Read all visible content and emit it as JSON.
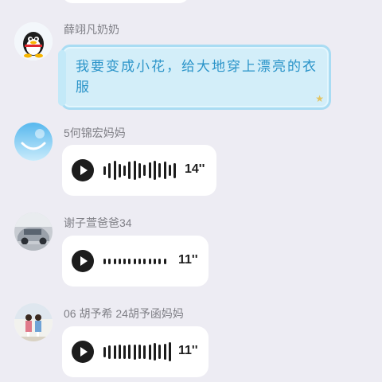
{
  "messages": [
    {
      "sender": "薛翊凡奶奶",
      "avatar_icon": "qq-penguin-avatar",
      "text": "我要变成小花，给大地穿上漂亮的衣服"
    },
    {
      "sender": "5何锦宏妈妈",
      "avatar_icon": "blue-smile-avatar",
      "voice": {
        "duration": "14''",
        "bar_heights_rel": [
          0.45,
          0.8,
          1,
          0.7,
          0.55,
          0.9,
          1,
          0.8,
          0.6,
          0.85,
          1,
          0.75,
          0.9,
          0.6,
          0.8
        ]
      }
    },
    {
      "sender": "谢子萱爸爸34",
      "avatar_icon": "car-photo-avatar",
      "voice": {
        "duration": "11''",
        "bar_heights_rel": [
          0.28,
          0.28,
          0.28,
          0.28,
          0.28,
          0.28,
          0.28,
          0.28,
          0.28,
          0.28,
          0.28,
          0.28,
          0.28
        ]
      }
    },
    {
      "sender": "06 胡予希 24胡予函妈妈",
      "avatar_icon": "children-photo-avatar",
      "voice": {
        "duration": "11''",
        "bar_heights_rel": [
          0.55,
          0.7,
          0.7,
          0.75,
          0.7,
          0.75,
          0.8,
          0.75,
          0.7,
          0.8,
          0.9,
          0.75,
          0.85,
          1
        ]
      }
    }
  ],
  "colors": {
    "background": "#edecf3",
    "bubble": "#ffffff",
    "text_bubble_fill": "#d3eef9",
    "text_bubble_text": "#2b94c9",
    "sender_name": "#7f7f86"
  }
}
